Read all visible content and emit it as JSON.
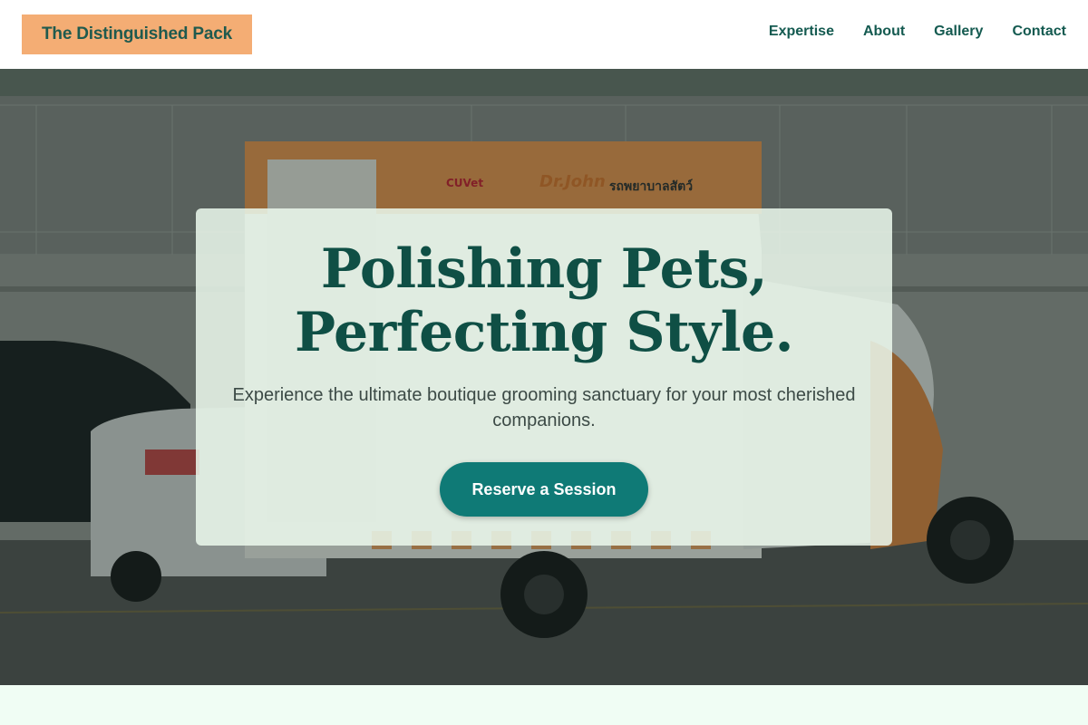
{
  "header": {
    "brand": "The Distinguished Pack",
    "nav": [
      {
        "label": "Expertise"
      },
      {
        "label": "About"
      },
      {
        "label": "Gallery"
      },
      {
        "label": "Contact"
      }
    ]
  },
  "hero": {
    "title_line1": "Polishing Pets,",
    "title_line2": "Perfecting Style.",
    "subtitle": "Experience the ultimate boutique grooming sanctuary for your most cherished companions.",
    "cta_label": "Reserve a Session",
    "background_image": {
      "van_text_brand": "Dr.John",
      "van_text_thai": "รถพยาบาลสัตว์",
      "van_logo": "CUVet"
    }
  },
  "colors": {
    "accent": "#0f7a76",
    "brand_bg": "#f4ad74",
    "heading": "#0f4f45",
    "nav_text": "#145a50",
    "page_bg": "#f0fdf4"
  }
}
